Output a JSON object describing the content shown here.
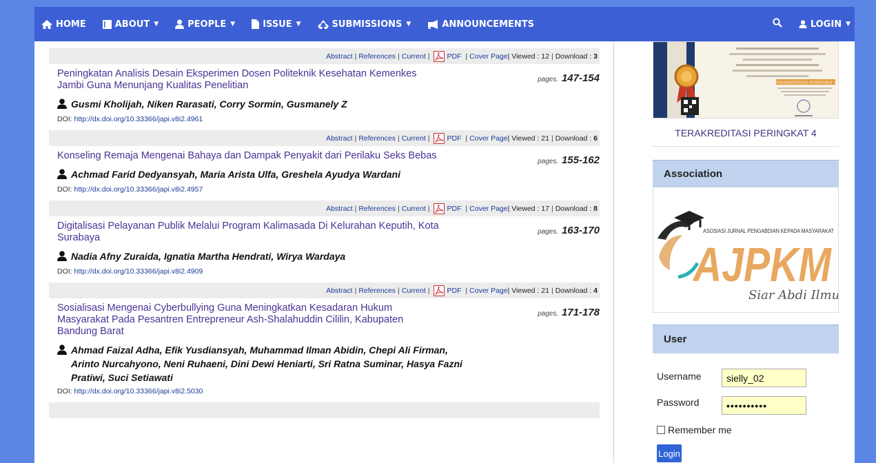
{
  "nav": {
    "home": "HOME",
    "about": "ABOUT",
    "people": "PEOPLE",
    "issue": "ISSUE",
    "submissions": "SUBMISSIONS",
    "announcements": "ANNOUNCEMENTS",
    "login": "LOGIN"
  },
  "article_bar": {
    "abstract": "Abstract",
    "references": "References",
    "current": "Current",
    "pdf": "PDF",
    "cover": "Cover Page",
    "viewed_label": "Viewed :",
    "download_label": "Download :"
  },
  "articles": [
    {
      "viewed": "12",
      "download": "3",
      "title": "Peningkatan Analisis Desain Eksperimen Dosen Politeknik Kesehatan Kemenkes Jambi Guna Menunjang Kualitas Penelitian",
      "pages_label": "pages.",
      "pages": "147-154",
      "authors": "Gusmi Kholijah, Niken Rarasati, Corry Sormin, Gusmanely Z",
      "doi_label": "DOI:",
      "doi": "http://dx.doi.org/10.33366/japi.v8i2.4961"
    },
    {
      "viewed": "21",
      "download": "6",
      "title": "Konseling Remaja Mengenai Bahaya dan Dampak Penyakit dari Perilaku Seks Bebas",
      "pages_label": "pages.",
      "pages": "155-162",
      "authors": "Achmad Farid Dedyansyah, Maria Arista Ulfa, Greshela Ayudya Wardani",
      "doi_label": "DOI:",
      "doi": "http://dx.doi.org/10.33366/japi.v8i2.4957"
    },
    {
      "viewed": "17",
      "download": "8",
      "title": "Digitalisasi Pelayanan Publik Melalui Program Kalimasada Di Kelurahan Keputih, Kota Surabaya",
      "pages_label": "pages.",
      "pages": "163-170",
      "authors": "Nadia Afny Zuraida, Ignatia Martha Hendrati, Wirya Wardaya",
      "doi_label": "DOI:",
      "doi": "http://dx.doi.org/10.33366/japi.v8i2.4909"
    },
    {
      "viewed": "21",
      "download": "4",
      "title": "Sosialisasi Mengenai Cyberbullying Guna Meningkatkan Kesadaran Hukum Masyarakat Pada Pesantren Entrepreneur Ash-Shalahuddin Cililin, Kabupaten Bandung Barat",
      "pages_label": "pages.",
      "pages": "171-178",
      "authors": "Ahmad Faizal Adha, Efik Yusdiansyah, Muhammad Ilman Abidin, Chepi Ali Firman, Arinto Nurcahyono, Neni Ruhaeni, Dini Dewi Heniarti, Sri Ratna Suminar, Hasya Fazni Pratiwi, Suci Setiawati",
      "doi_label": "DOI:",
      "doi": "http://dx.doi.org/10.33366/japi.v8i2.5030"
    }
  ],
  "sidebar": {
    "accreditation_link": "TERAKREDITASI PERINGKAT 4",
    "certificate_ribbon": "TERAKREDITASI PERINGKAT 4",
    "association_title": "Association",
    "assoc_logo": {
      "tagline": "ASOSIASI JURNAL PENGABDIAN KEPADA MASYARAKAT",
      "acronym": "AJPKM",
      "script": "Siar Abdi Ilmuwan"
    },
    "user_title": "User",
    "username_label": "Username",
    "username_value": "sielly_02",
    "password_label": "Password",
    "password_value": "••••••••••",
    "remember_label": "Remember me",
    "login_button": "Login"
  },
  "colors": {
    "navbar": "#3d5fd6",
    "background": "#5c86e6",
    "title_link": "#4a3294",
    "block_header": "#bfd3ee",
    "input_bg": "#ffffc8",
    "login_button": "#2f63d6"
  }
}
